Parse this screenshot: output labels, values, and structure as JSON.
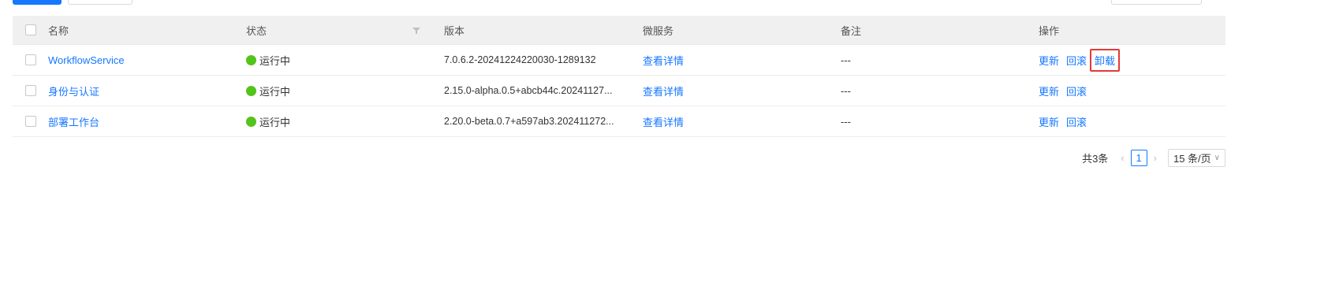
{
  "table": {
    "headers": {
      "name": "名称",
      "status": "状态",
      "version": "版本",
      "microservice": "微服务",
      "remark": "备注",
      "ops": "操作"
    },
    "rows": [
      {
        "name": "WorkflowService",
        "status": "运行中",
        "version": "7.0.6.2-20241224220030-1289132",
        "microservice": "查看详情",
        "remark": "---",
        "ops": [
          "更新",
          "回滚",
          "卸载"
        ]
      },
      {
        "name": "身份与认证",
        "status": "运行中",
        "version": "2.15.0-alpha.0.5+abcb44c.20241127...",
        "microservice": "查看详情",
        "remark": "---",
        "ops": [
          "更新",
          "回滚"
        ]
      },
      {
        "name": "部署工作台",
        "status": "运行中",
        "version": "2.20.0-beta.0.7+a597ab3.202411272...",
        "microservice": "查看详情",
        "remark": "---",
        "ops": [
          "更新",
          "回滚"
        ]
      }
    ]
  },
  "pagination": {
    "total": "共3条",
    "current_page": "1",
    "page_size": "15 条/页",
    "prev_icon": "chevron-left-icon",
    "next_icon": "chevron-right-icon"
  },
  "colors": {
    "primary": "#1677ff",
    "running": "#52c41a",
    "highlight": "#e53935",
    "header_bg": "#f0f0f0"
  }
}
